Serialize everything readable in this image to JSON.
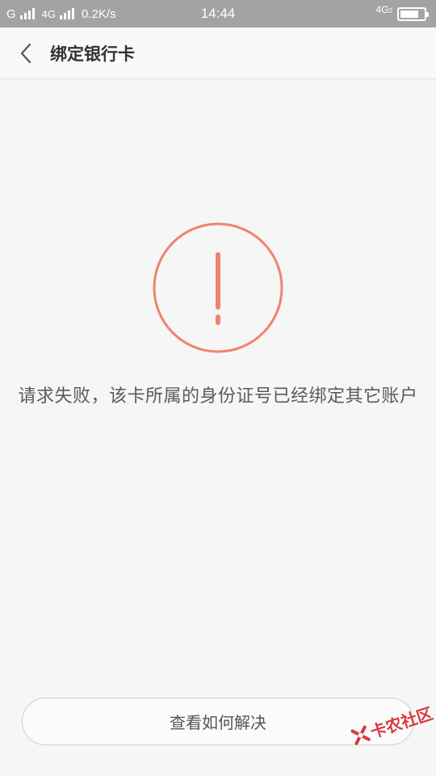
{
  "status_bar": {
    "carrier1": "G",
    "carrier2": "4G",
    "speed": "0.2K/s",
    "time": "14:44",
    "network_type": "4G",
    "network_sub": "2"
  },
  "header": {
    "back_icon": "chevron-left-icon",
    "title": "绑定银行卡"
  },
  "main": {
    "icon": "exclamation-circle-icon",
    "accent_color": "#f0836d",
    "message": "请求失败，该卡所属的身份证号已经绑定其它账户"
  },
  "footer": {
    "button_label": "查看如何解决"
  },
  "watermark": {
    "text": "卡农社区",
    "color": "#d9383c"
  }
}
